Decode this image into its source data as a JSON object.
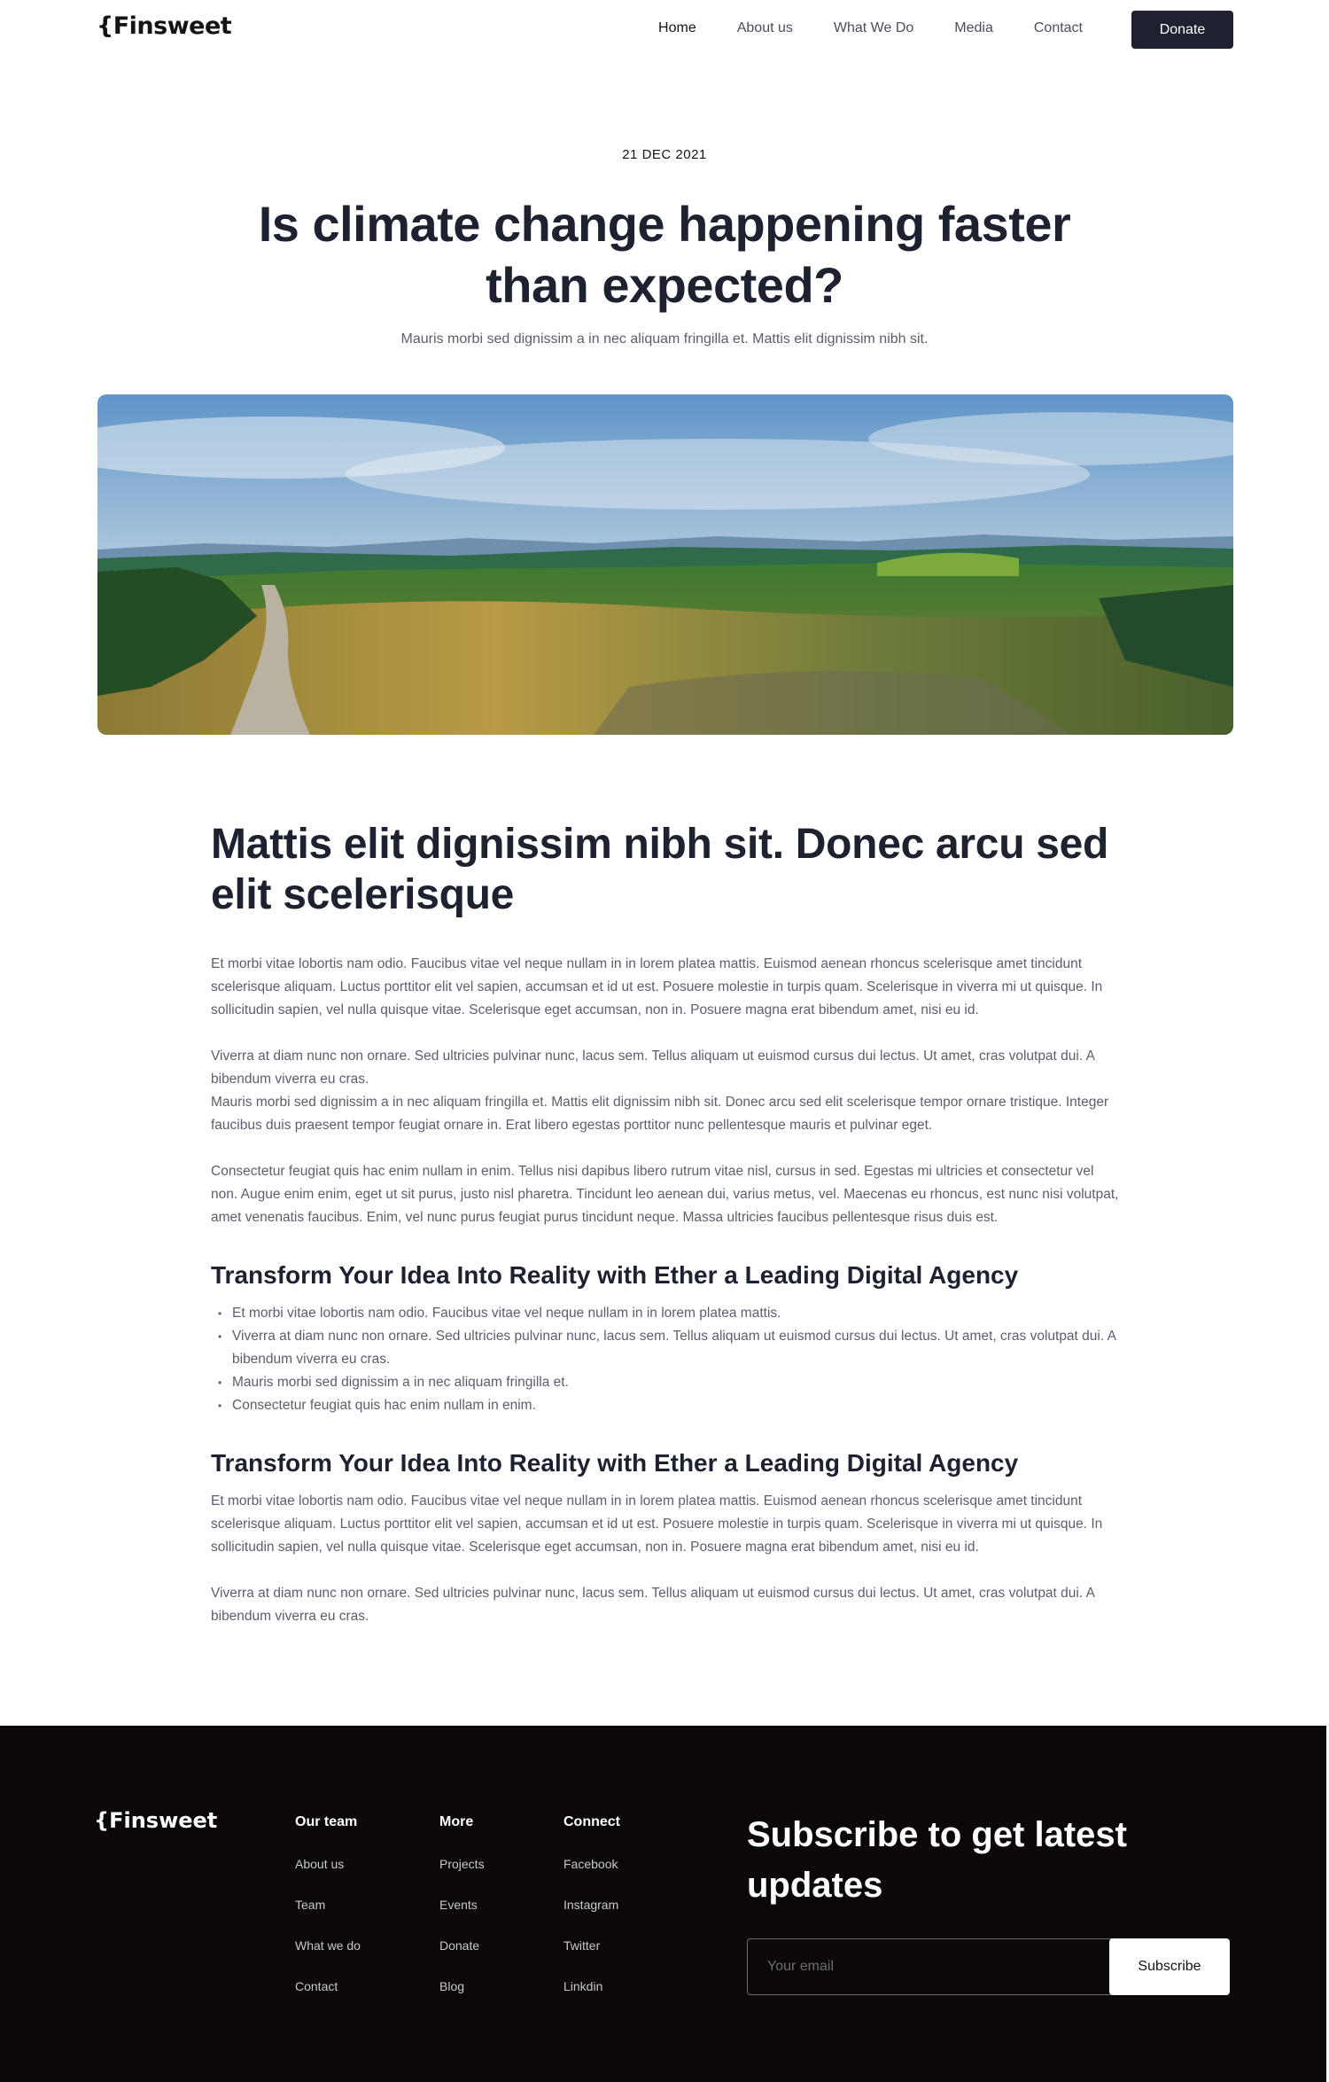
{
  "nav": {
    "logo": "{Finsweet",
    "links": [
      "Home",
      "About us",
      "What We Do",
      "Media",
      "Contact"
    ],
    "donate_label": "Donate"
  },
  "hero": {
    "date": "21 DEC 2021",
    "title": "Is climate change happening faster than expected?",
    "subtitle": "Mauris morbi sed dignissim a in nec aliquam fringilla et. Mattis elit dignissim nibh sit."
  },
  "article": {
    "heading": "Mattis elit dignissim nibh sit. Donec arcu sed elit scelerisque",
    "para1": "Et morbi vitae lobortis nam odio. Faucibus vitae vel neque nullam in in lorem platea mattis. Euismod aenean rhoncus scelerisque amet tincidunt scelerisque aliquam. Luctus porttitor elit vel sapien, accumsan et id ut est. Posuere molestie in turpis quam. Scelerisque in viverra mi ut quisque. In sollicitudin sapien, vel nulla quisque vitae. Scelerisque eget accumsan, non in. Posuere magna erat bibendum amet, nisi eu id.",
    "para2a": "Viverra at diam nunc non ornare. Sed ultricies pulvinar nunc, lacus sem. Tellus aliquam ut euismod cursus dui lectus. Ut amet, cras volutpat dui. A bibendum viverra eu cras.",
    "para2b": "Mauris morbi sed dignissim a in nec aliquam fringilla et. Mattis elit dignissim nibh sit. Donec arcu sed elit scelerisque tempor ornare tristique. Integer faucibus duis praesent tempor feugiat ornare in. Erat libero egestas porttitor nunc pellentesque mauris et pulvinar eget.",
    "para3": "Consectetur feugiat quis hac enim nullam in enim. Tellus nisi dapibus libero rutrum vitae nisl, cursus in sed. Egestas mi ultricies et consectetur vel non. Augue enim enim, eget ut sit purus, justo nisl pharetra. Tincidunt leo aenean dui, varius metus, vel. Maecenas eu rhoncus, est nunc nisi volutpat, amet venenatis faucibus. Enim, vel nunc purus feugiat purus tincidunt neque. Massa ultricies faucibus pellentesque risus duis est.",
    "subheading1": "Transform Your Idea Into Reality with Ether a Leading Digital Agency",
    "bullets": [
      "Et morbi vitae lobortis nam odio. Faucibus vitae vel neque nullam in in lorem platea mattis.",
      "Viverra at diam nunc non ornare. Sed ultricies pulvinar nunc, lacus sem. Tellus aliquam ut euismod cursus dui lectus. Ut amet, cras volutpat dui. A bibendum viverra eu cras.",
      "Mauris morbi sed dignissim a in nec aliquam fringilla et.",
      "Consectetur feugiat quis hac enim nullam in enim."
    ],
    "subheading2": "Transform Your Idea Into Reality with Ether a Leading Digital Agency",
    "para4": "Et morbi vitae lobortis nam odio. Faucibus vitae vel neque nullam in in lorem platea mattis. Euismod aenean rhoncus scelerisque amet tincidunt scelerisque aliquam. Luctus porttitor elit vel sapien, accumsan et id ut est. Posuere molestie in turpis quam. Scelerisque in viverra mi ut quisque. In sollicitudin sapien, vel nulla quisque vitae. Scelerisque eget accumsan, non in. Posuere magna erat bibendum amet, nisi eu id.",
    "para5": "Viverra at diam nunc non ornare. Sed ultricies pulvinar nunc, lacus sem. Tellus aliquam ut euismod cursus dui lectus. Ut amet, cras volutpat dui. A bibendum viverra eu cras."
  },
  "footer": {
    "logo": "{Finsweet",
    "columns": [
      {
        "title": "Our team",
        "links": [
          "About us",
          "Team",
          "What we do",
          "Contact"
        ]
      },
      {
        "title": "More",
        "links": [
          "Projects",
          "Events",
          "Donate",
          "Blog"
        ]
      },
      {
        "title": "Connect",
        "links": [
          "Facebook",
          "Instagram",
          "Twitter",
          "Linkdin"
        ]
      }
    ],
    "subscribe_title": "Subscribe to get latest updates",
    "email_placeholder": "Your email",
    "subscribe_label": "Subscribe"
  },
  "colors": {
    "dark_navy": "#1e2130",
    "footer_bg": "#0c0807",
    "body_text": "#5b5e6e"
  }
}
